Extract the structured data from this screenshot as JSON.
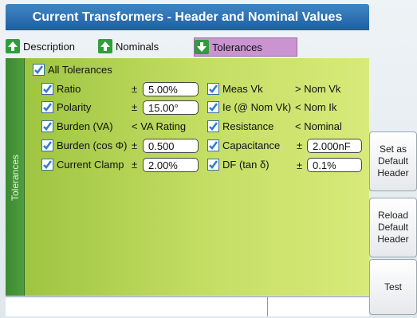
{
  "title": "Current Transformers - Header and Nominal Values",
  "tabs": [
    {
      "label": "Description",
      "icon": "arrow-up-icon",
      "selected": false
    },
    {
      "label": "Nominals",
      "icon": "arrow-up-icon",
      "selected": false
    },
    {
      "label": "Tolerances",
      "icon": "arrow-down-icon",
      "selected": true
    }
  ],
  "side_tab_label": "Tolerances",
  "all_tolerances": {
    "label": "All Tolerances",
    "checked": true
  },
  "left_rows": [
    {
      "label": "Ratio",
      "prefix": "±",
      "value": "5.00%",
      "checked": true
    },
    {
      "label": "Polarity",
      "prefix": "±",
      "value": "15.00°",
      "checked": true
    },
    {
      "label": "Burden (VA)",
      "text": "< VA Rating",
      "checked": true
    },
    {
      "label": "Burden (cos Φ)",
      "prefix": "±",
      "value": "0.500",
      "checked": true
    },
    {
      "label": "Current Clamp",
      "prefix": "±",
      "value": "2.00%",
      "checked": true
    }
  ],
  "right_rows": [
    {
      "label": "Meas Vk",
      "text": "> Nom Vk",
      "checked": true
    },
    {
      "label": "Ie (@ Nom Vk)",
      "text": "< Nom Ik",
      "checked": true
    },
    {
      "label": "Resistance",
      "text": "< Nominal",
      "checked": true
    },
    {
      "label": "Capacitance",
      "prefix": "±",
      "value": "2.000nF",
      "checked": true
    },
    {
      "label": "DF (tan δ)",
      "prefix": "±",
      "value": "0.1%",
      "checked": true
    }
  ],
  "buttons": {
    "set_default": "Set as\nDefault\nHeader",
    "reload_default": "Reload\nDefault\nHeader",
    "test": "Test"
  },
  "colors": {
    "title_bar": "#2a6fb3",
    "panel": "#b8d65a",
    "selected_tab": "#c994d0",
    "side_tab": "#4f9d3e",
    "check": "#2f7fd0"
  }
}
